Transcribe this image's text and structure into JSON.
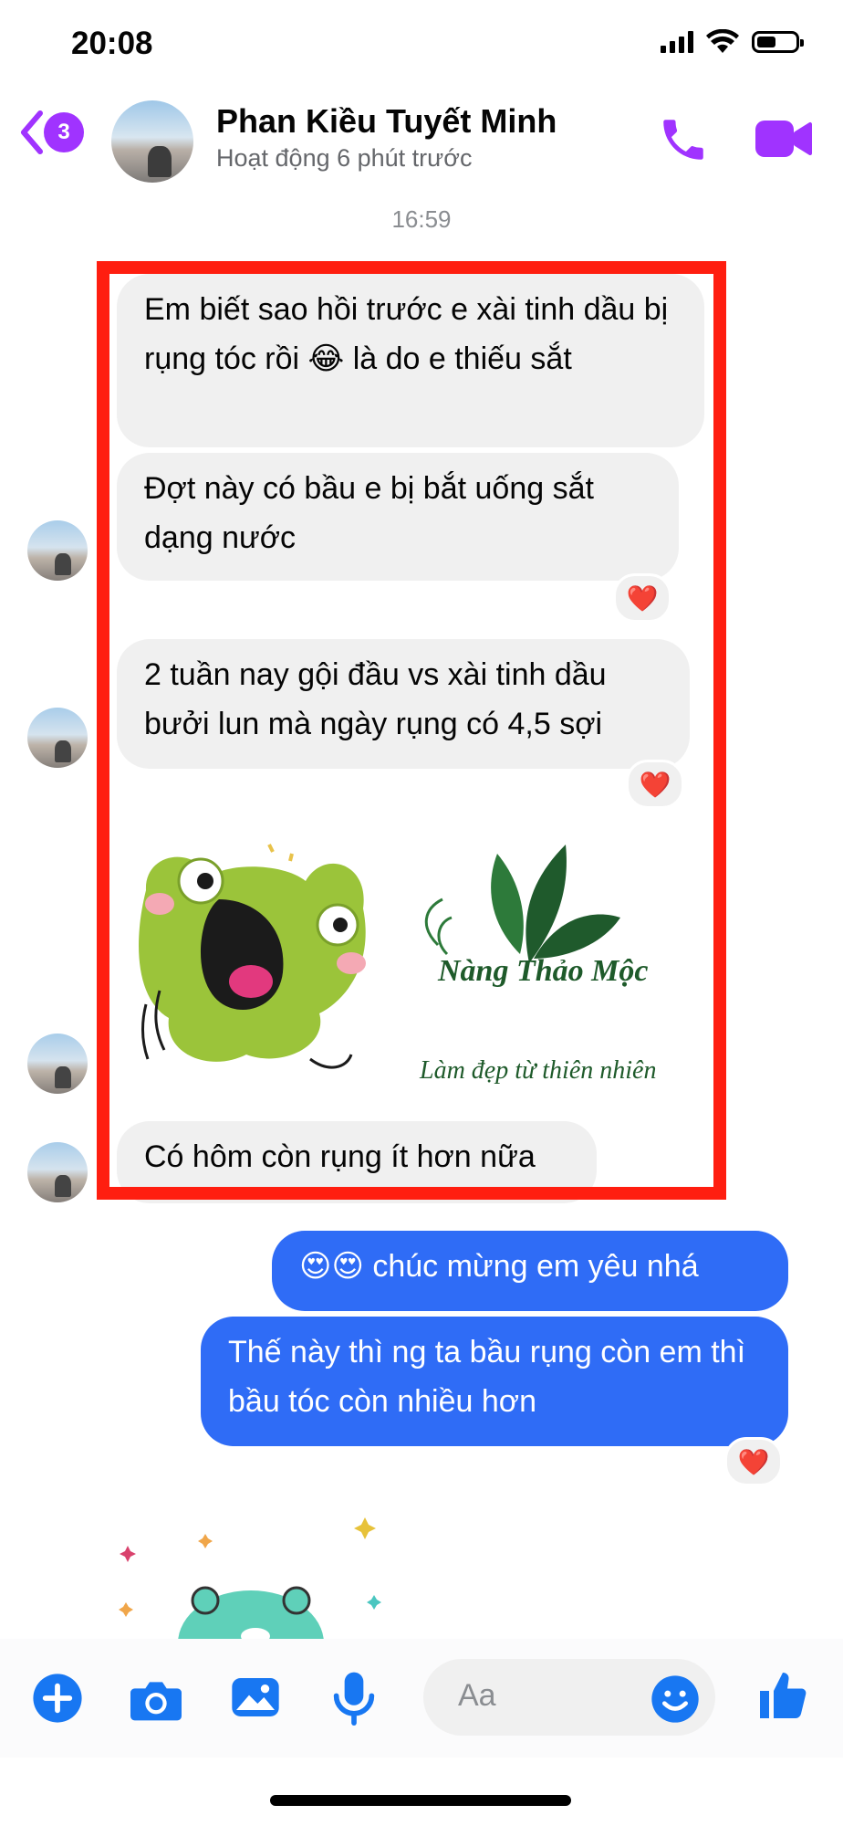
{
  "status_bar": {
    "time": "20:08"
  },
  "header": {
    "back_badge_count": "3",
    "contact_name": "Phan Kiều Tuyết Minh",
    "contact_status": "Hoạt động 6 phút trước"
  },
  "chat": {
    "timestamp": "16:59",
    "received": [
      {
        "text": "Em biết sao hồi trước e xài tinh dầu bị rụng tóc rồi 😂 là do e thiếu sắt"
      },
      {
        "text": "Đợt này có bầu e bị bắt uống sắt dạng nước",
        "reaction": "❤️"
      },
      {
        "text": "2 tuần nay gội đầu vs xài tinh dầu bưởi lun mà ngày rụng có 4,5 sợi",
        "reaction": "❤️"
      },
      {
        "text": "Có hôm còn rụng ít hơn nữa"
      }
    ],
    "sticker": {
      "brand_name": "Nàng Thảo Mộc",
      "tagline": "Làm đẹp từ thiên nhiên"
    },
    "sent": [
      {
        "text": "😍😍 chúc mừng em yêu nhá"
      },
      {
        "text": "Thế này thì ng ta bầu rụng còn em thì bầu tóc còn nhiều hơn",
        "reaction": "❤️"
      }
    ]
  },
  "composer": {
    "placeholder": "Aa"
  },
  "colors": {
    "accent_purple": "#a033ff",
    "messenger_blue": "#2f6cf6",
    "composer_icon_blue": "#1877f2",
    "frame_red": "#ff1e10"
  },
  "icons": [
    "signal-icon",
    "wifi-icon",
    "battery-icon",
    "back-chevron-icon",
    "phone-icon",
    "video-camera-icon",
    "plus-icon",
    "camera-icon",
    "gallery-icon",
    "microphone-icon",
    "emoji-icon",
    "like-thumb-icon"
  ]
}
